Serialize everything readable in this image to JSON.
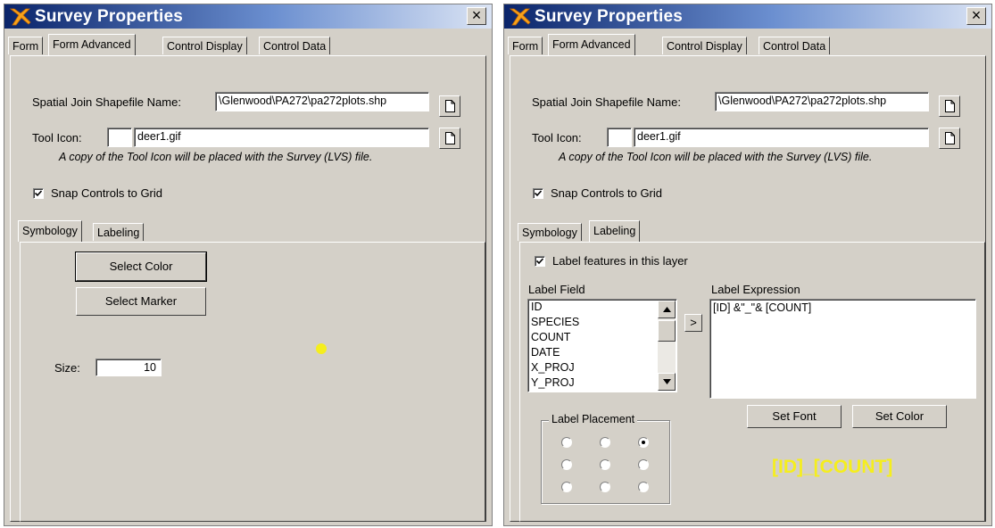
{
  "title": "Survey Properties",
  "close_glyph": "×",
  "tabs": [
    "Form",
    "Form Advanced",
    "Control Display",
    "Control Data"
  ],
  "spatial_join": {
    "label": "Spatial Join Shapefile Name:",
    "value": "\\Glenwood\\PA272\\pa272plots.shp"
  },
  "tool_icon": {
    "label": "Tool Icon:",
    "value": "deer1.gif",
    "note": "A copy of the Tool Icon will be placed with the Survey (LVS) file."
  },
  "snap_controls": {
    "label": "Snap Controls to Grid",
    "checked": true
  },
  "subtabs": [
    "Symbology",
    "Labeling"
  ],
  "symbology": {
    "select_color_label": "Select Color",
    "select_marker_label": "Select Marker",
    "size_label": "Size:",
    "size_value": "10",
    "marker_color": "#f5ee1d"
  },
  "labeling": {
    "label_features": {
      "label": "Label features in this layer",
      "checked": true
    },
    "label_field_title": "Label Field",
    "fields": [
      "ID",
      "SPECIES",
      "COUNT",
      "DATE",
      "X_PROJ",
      "Y_PROJ"
    ],
    "add_button_label": ">",
    "expression_title": "Label Expression",
    "expression": "[ID] &\"_\"& [COUNT]",
    "set_font_label": "Set Font",
    "set_color_label": "Set Color",
    "placement_title": "Label Placement",
    "placement_selected": 2,
    "preview_text": "[ID]_[COUNT]",
    "preview_color": "#f5ee1d"
  },
  "colors": {
    "dialog_bg": "#d4d0c8",
    "titlebar_start": "#0a246a",
    "titlebar_end": "#dbe4f4"
  }
}
